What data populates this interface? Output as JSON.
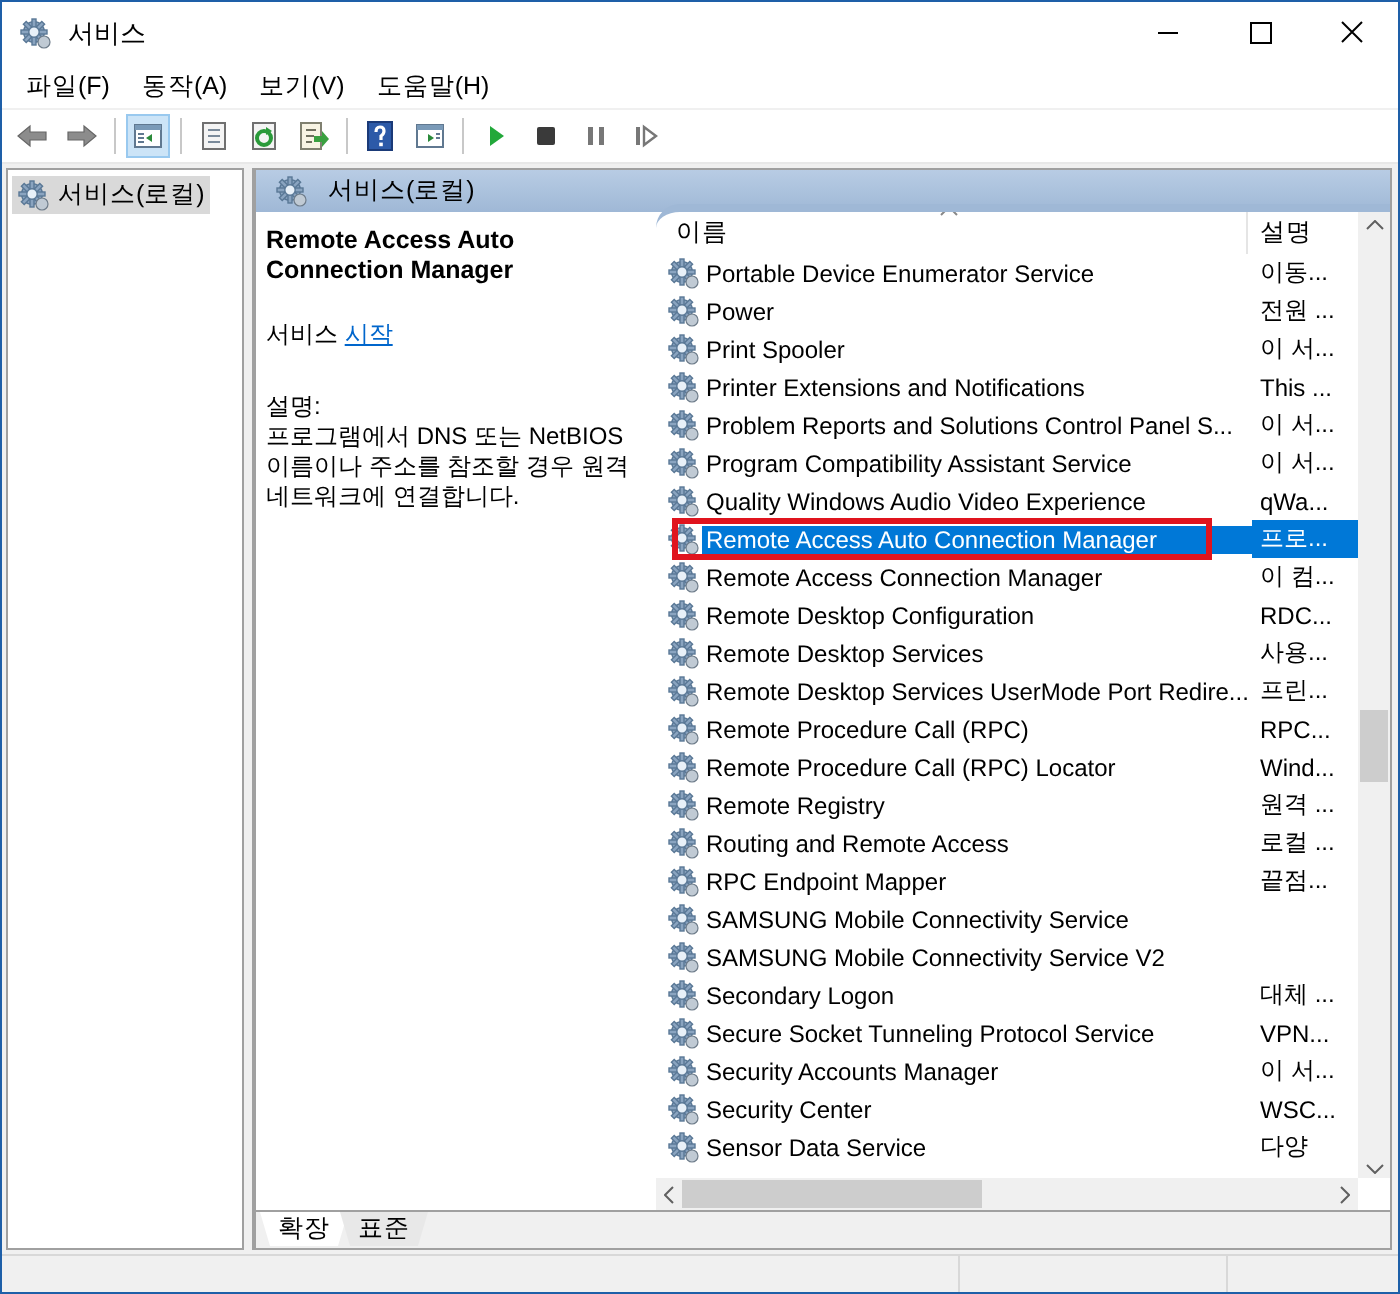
{
  "window": {
    "title": "서비스"
  },
  "menu": [
    {
      "label": "파일(F)"
    },
    {
      "label": "동작(A)"
    },
    {
      "label": "보기(V)"
    },
    {
      "label": "도움말(H)"
    }
  ],
  "toolbar": [
    {
      "kind": "back",
      "pressed": false
    },
    {
      "kind": "forward",
      "pressed": false
    },
    {
      "kind": "separator"
    },
    {
      "kind": "tree",
      "pressed": true
    },
    {
      "kind": "separator"
    },
    {
      "kind": "properties",
      "pressed": false
    },
    {
      "kind": "refresh",
      "pressed": false
    },
    {
      "kind": "export",
      "pressed": false
    },
    {
      "kind": "separator"
    },
    {
      "kind": "help",
      "pressed": false
    },
    {
      "kind": "view",
      "pressed": false
    },
    {
      "kind": "separator"
    },
    {
      "kind": "start",
      "pressed": false
    },
    {
      "kind": "stop",
      "pressed": false
    },
    {
      "kind": "pause",
      "pressed": false
    },
    {
      "kind": "resume",
      "pressed": false
    }
  ],
  "tree": {
    "items": [
      {
        "label": "서비스(로컬)",
        "selected": true
      }
    ]
  },
  "pane_header": "서비스(로컬)",
  "detail": {
    "title": "Remote Access Auto Connection Manager",
    "action_prefix": "서비스",
    "action_link": "시작",
    "description_label": "설명:",
    "description": "프로그램에서 DNS 또는 NetBIOS 이름이나 주소를 참조할 경우 원격 네트워크에 연결합니다."
  },
  "table": {
    "columns": [
      "이름",
      "설명"
    ],
    "rows": [
      {
        "name": "Portable Device Enumerator Service",
        "description": "이동...",
        "selected": false,
        "outlined": false
      },
      {
        "name": "Power",
        "description": "전원 ...",
        "selected": false,
        "outlined": false
      },
      {
        "name": "Print Spooler",
        "description": "이 서...",
        "selected": false,
        "outlined": false
      },
      {
        "name": "Printer Extensions and Notifications",
        "description": "This ...",
        "selected": false,
        "outlined": false
      },
      {
        "name": "Problem Reports and Solutions Control Panel S...",
        "description": "이 서...",
        "selected": false,
        "outlined": false
      },
      {
        "name": "Program Compatibility Assistant Service",
        "description": "이 서...",
        "selected": false,
        "outlined": false
      },
      {
        "name": "Quality Windows Audio Video Experience",
        "description": "qWa...",
        "selected": false,
        "outlined": false
      },
      {
        "name": "Remote Access Auto Connection Manager",
        "description": "프로...",
        "selected": true,
        "outlined": true
      },
      {
        "name": "Remote Access Connection Manager",
        "description": "이 컴...",
        "selected": false,
        "outlined": false
      },
      {
        "name": "Remote Desktop Configuration",
        "description": "RDC...",
        "selected": false,
        "outlined": false
      },
      {
        "name": "Remote Desktop Services",
        "description": "사용...",
        "selected": false,
        "outlined": false
      },
      {
        "name": "Remote Desktop Services UserMode Port Redire...",
        "description": "프린...",
        "selected": false,
        "outlined": false
      },
      {
        "name": "Remote Procedure Call (RPC)",
        "description": "RPC...",
        "selected": false,
        "outlined": false
      },
      {
        "name": "Remote Procedure Call (RPC) Locator",
        "description": "Wind...",
        "selected": false,
        "outlined": false
      },
      {
        "name": "Remote Registry",
        "description": "원격 ...",
        "selected": false,
        "outlined": false
      },
      {
        "name": "Routing and Remote Access",
        "description": "로컬 ...",
        "selected": false,
        "outlined": false
      },
      {
        "name": "RPC Endpoint Mapper",
        "description": "끝점...",
        "selected": false,
        "outlined": false
      },
      {
        "name": "SAMSUNG Mobile Connectivity Service",
        "selected": false,
        "outlined": false
      },
      {
        "name": "SAMSUNG Mobile Connectivity Service V2",
        "selected": false,
        "outlined": false
      },
      {
        "name": "Secondary Logon",
        "description": "대체 ...",
        "selected": false,
        "outlined": false
      },
      {
        "name": "Secure Socket Tunneling Protocol Service",
        "description": "VPN...",
        "selected": false,
        "outlined": false
      },
      {
        "name": "Security Accounts Manager",
        "description": "이 서...",
        "selected": false,
        "outlined": false
      },
      {
        "name": "Security Center",
        "description": "WSC...",
        "selected": false,
        "outlined": false
      },
      {
        "name": "Sensor Data Service",
        "description": "다양",
        "selected": false,
        "outlined": false
      }
    ]
  },
  "tabs": [
    {
      "label": "확장",
      "selected": true
    },
    {
      "label": "표준",
      "selected": false
    }
  ]
}
